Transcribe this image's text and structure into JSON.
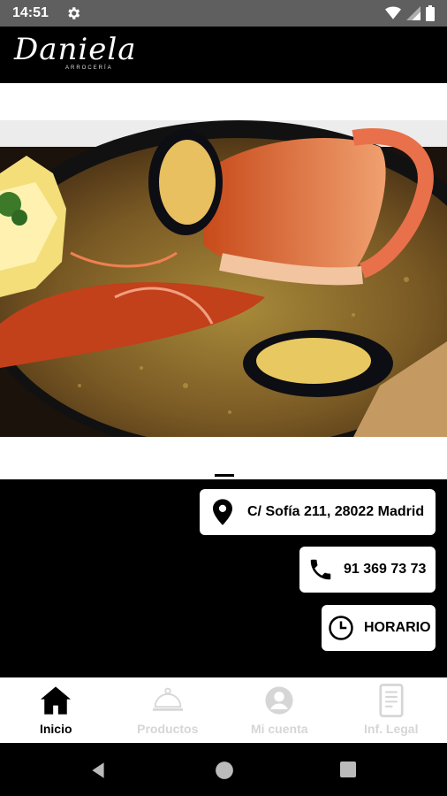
{
  "status_bar": {
    "time": "14:51",
    "icons": [
      "gear-icon",
      "wifi-icon",
      "signal-icon",
      "battery-icon"
    ]
  },
  "header": {
    "logo_text": "Daniela",
    "logo_subtext": "ARROCERÍA"
  },
  "hero": {
    "alt": "paella-photo"
  },
  "contact": {
    "address": "C/ Sofía 211, 28022 Madrid",
    "phone": "91 369 73 73",
    "hours_label": "HORARIO"
  },
  "bottom_nav": {
    "items": [
      {
        "label": "Inicio",
        "icon": "home-icon",
        "active": true
      },
      {
        "label": "Productos",
        "icon": "cloche-icon",
        "active": false
      },
      {
        "label": "Mi cuenta",
        "icon": "account-icon",
        "active": false
      },
      {
        "label": "Inf. Legal",
        "icon": "legal-document-icon",
        "active": false
      }
    ]
  },
  "colors": {
    "status_bar": "#5f5f5f",
    "background": "#000000",
    "pill": "#ffffff",
    "nav_inactive": "#d6d6d6"
  }
}
